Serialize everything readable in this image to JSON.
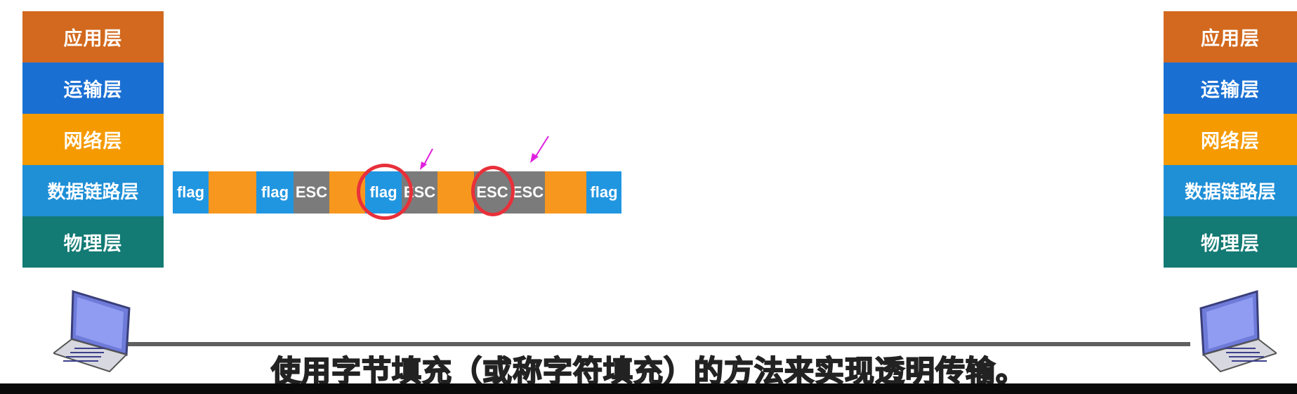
{
  "layers": {
    "application": "应用层",
    "transport": "运输层",
    "network": "网络层",
    "datalink": "数据链路层",
    "physical": "物理层"
  },
  "frame": {
    "flag_label": "flag",
    "esc_label": "ESC"
  },
  "subtitle": "使用字节填充（或称字符填充）的方法来实现透明传输。",
  "colors": {
    "application": "#d2691e",
    "transport": "#1a6fd3",
    "network": "#f59a00",
    "datalink": "#1f8fd6",
    "physical": "#137a74",
    "flag": "#2196e0",
    "esc": "#7b7b7b",
    "data": "#f7971e",
    "highlight_circle": "#e8303a",
    "arrow": "#e020e0"
  }
}
